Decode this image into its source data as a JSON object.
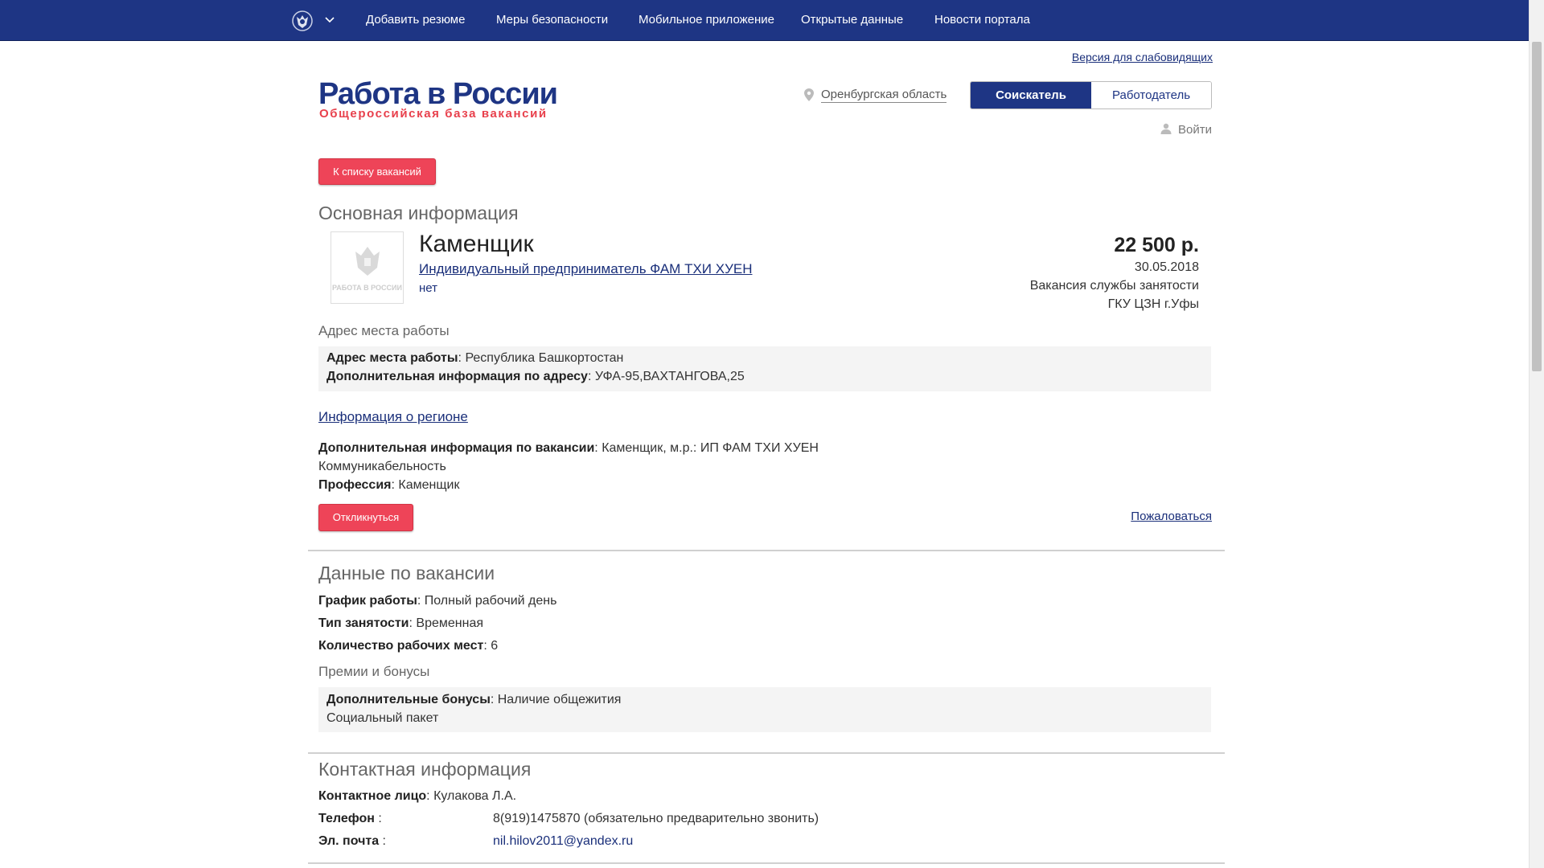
{
  "nav": {
    "links": [
      "Добавить резюме",
      "Меры безопасности",
      "Мобильное приложение",
      "Открытые данные",
      "Новости портала"
    ]
  },
  "header": {
    "accessibility_link": "Версия для слабовидящих",
    "logo_title": "Работа в России",
    "logo_subtitle": "Общероссийская база вакансий",
    "region": "Оренбургская область",
    "role_seeker": "Соискатель",
    "role_employer": "Работодатель",
    "login": "Войти"
  },
  "back_button": "К списку вакансий",
  "main_info": {
    "section_title": "Основная информация",
    "logo_caption": "РАБОТА В РОССИИ",
    "vacancy_title": "Каменщик",
    "employer": "Индивидуальный предприниматель ФАМ ТХИ ХУЕН",
    "employer_sub": "нет",
    "salary": "22 500 р.",
    "date": "30.05.2018",
    "source": "Вакансия службы занятости",
    "agency": "ГКУ ЦЗН г.Уфы",
    "address_heading": "Адрес места работы",
    "address_label": "Адрес места работы",
    "address_value": "Республика Башкортостан",
    "address_extra_label": "Дополнительная информация по адресу",
    "address_extra_value": "УФА-95,ВАХТАНГОВА,25",
    "region_link": "Информация о регионе",
    "extra_label": "Дополнительная информация по вакансии",
    "extra_value": "Каменщик, м.р.: ИП ФАМ ТХИ ХУЕН",
    "extra_value2": "Коммуникабельность",
    "profession_label": "Профессия",
    "profession_value": "Каменщик",
    "respond_button": "Откликнуться",
    "complain_link": "Пожаловаться"
  },
  "vacancy_data": {
    "section_title": "Данные по вакансии",
    "schedule_label": "График работы",
    "schedule_value": "Полный рабочий день",
    "employment_label": "Тип занятости",
    "employment_value": "Временная",
    "places_label": "Количество рабочих мест",
    "places_value": "6",
    "bonuses_heading": "Премии и бонусы",
    "bonuses_label": "Дополнительные бонусы",
    "bonuses_value": "Наличие общежития",
    "bonuses_value2": "Социальный пакет"
  },
  "contacts": {
    "section_title": "Контактная информация",
    "person_label": "Контактное лицо",
    "person_value": "Кулакова Л.А.",
    "phone_label": "Телефон",
    "phone_value": "8(919)1475870 (обязательно предварительно звонить)",
    "email_label": "Эл. почта",
    "email_value": "nil.hilov2011@yandex.ru"
  },
  "colors": {
    "brand_blue": "#1e3584",
    "accent_red": "#ee4458"
  }
}
